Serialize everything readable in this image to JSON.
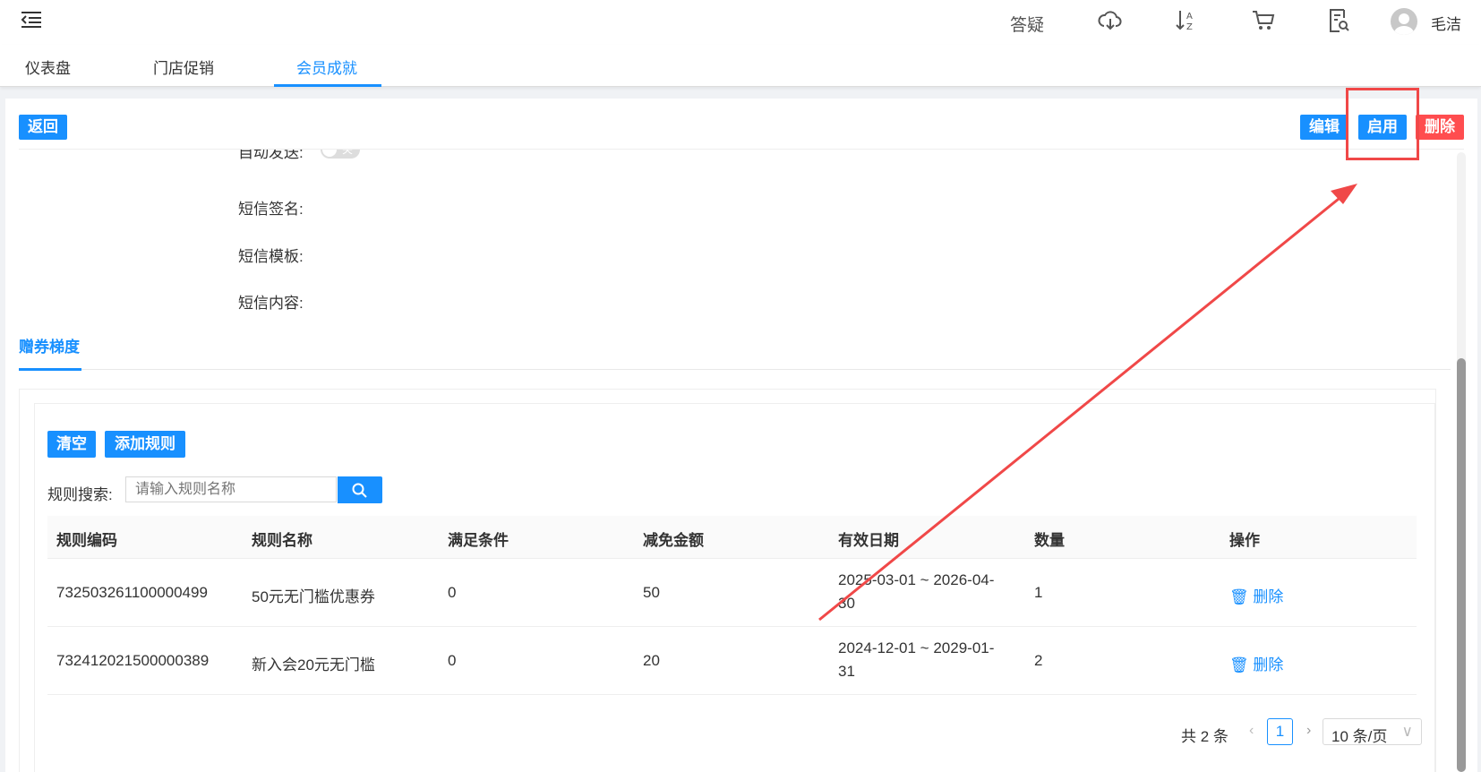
{
  "header": {
    "help": "答疑",
    "user": "毛洁",
    "icons": [
      "menu-fold-icon",
      "cloud-download-icon",
      "sort-az-icon",
      "cart-icon",
      "document-search-icon",
      "avatar-icon"
    ]
  },
  "tabs": [
    {
      "label": "仪表盘"
    },
    {
      "label": "门店促销"
    },
    {
      "label": "会员成就",
      "active": true
    }
  ],
  "toolbar": {
    "back": "返回",
    "edit": "编辑",
    "enable": "启用",
    "delete": "删除"
  },
  "form": {
    "auto_send": "自动发送:",
    "auto_send_toggle": "关",
    "sms_signature": "短信签名:",
    "sms_template": "短信模板:",
    "sms_content": "短信内容:"
  },
  "section_tab": "赠券梯度",
  "rules": {
    "clear": "清空",
    "add": "添加规则",
    "search_label": "规则搜索:",
    "search_placeholder": "请输入规则名称",
    "columns": [
      "规则编码",
      "规则名称",
      "满足条件",
      "减免金额",
      "有效日期",
      "数量",
      "操作"
    ],
    "rows": [
      {
        "code": "732503261100000499",
        "name": "50元无门槛优惠券",
        "condition": "0",
        "amount": "50",
        "date1": "2025-03-01 ~ 2026-04-",
        "date2": "30",
        "qty": "1",
        "action": "删除"
      },
      {
        "code": "732412021500000389",
        "name": "新入会20元无门槛",
        "condition": "0",
        "amount": "20",
        "date1": "2024-12-01 ~ 2029-01-",
        "date2": "31",
        "qty": "2",
        "action": "删除"
      }
    ]
  },
  "pagination": {
    "total": "共 2 条",
    "current": "1",
    "page_size": "10 条/页"
  },
  "colors": {
    "primary": "#1890ff",
    "danger": "#ff4d4f",
    "annotation": "#f04848"
  }
}
